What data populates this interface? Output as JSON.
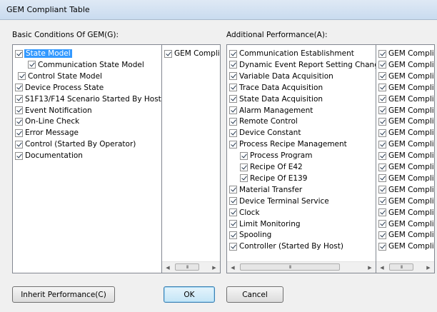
{
  "window": {
    "title": "GEM Compliant Table"
  },
  "basic": {
    "label": "Basic Conditions Of GEM(G):",
    "items": [
      {
        "label": "State Model",
        "indent": 0,
        "selected": true
      },
      {
        "label": "Communication State Model",
        "indent": 2,
        "selected": false
      },
      {
        "label": "Control State Model",
        "indent": 1,
        "selected": false
      },
      {
        "label": "Device Process State",
        "indent": 0,
        "selected": false
      },
      {
        "label": "S1F13/F14 Scenario Started By Host",
        "indent": 0,
        "selected": false
      },
      {
        "label": "Event Notification",
        "indent": 0,
        "selected": false
      },
      {
        "label": "On-Line Check",
        "indent": 0,
        "selected": false
      },
      {
        "label": "Error Message",
        "indent": 0,
        "selected": false
      },
      {
        "label": "Control (Started By Operator)",
        "indent": 0,
        "selected": false
      },
      {
        "label": "Documentation",
        "indent": 0,
        "selected": false
      }
    ],
    "compliant": [
      "GEM Complia"
    ],
    "scroll_thumb": "III"
  },
  "additional": {
    "label": "Additional Performance(A):",
    "items": [
      {
        "label": "Communication Establishment",
        "indent": 0
      },
      {
        "label": "Dynamic Event Report Setting Change",
        "indent": 0
      },
      {
        "label": "Variable Data Acquisition",
        "indent": 0
      },
      {
        "label": "Trace Data Acquisition",
        "indent": 0
      },
      {
        "label": "State Data Acquisition",
        "indent": 0
      },
      {
        "label": "Alarm Management",
        "indent": 0
      },
      {
        "label": "Remote Control",
        "indent": 0
      },
      {
        "label": "Device Constant",
        "indent": 0
      },
      {
        "label": "Process Recipe Management",
        "indent": 0
      },
      {
        "label": "Process Program",
        "indent": 1
      },
      {
        "label": "Recipe Of E42",
        "indent": 1
      },
      {
        "label": "Recipe Of E139",
        "indent": 1
      },
      {
        "label": "Material Transfer",
        "indent": 0
      },
      {
        "label": "Device Terminal Service",
        "indent": 0
      },
      {
        "label": "Clock",
        "indent": 0
      },
      {
        "label": "Limit Monitoring",
        "indent": 0
      },
      {
        "label": "Spooling",
        "indent": 0
      },
      {
        "label": "Controller (Started By Host)",
        "indent": 0
      }
    ],
    "compliant_label": "GEM Complia",
    "scroll_thumb": "III"
  },
  "buttons": {
    "inherit": "Inherit Performance(C)",
    "ok": "OK",
    "cancel": "Cancel"
  }
}
